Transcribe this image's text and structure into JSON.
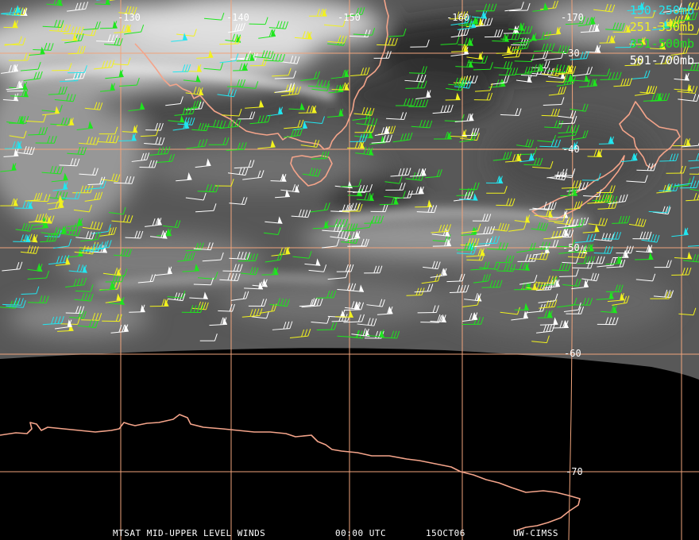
{
  "map": {
    "longitude_labels": [
      "-130",
      "-140",
      "-150",
      "-160",
      "-170"
    ],
    "latitude_labels": [
      "-30",
      "-40",
      "-50",
      "-60",
      "-70"
    ],
    "colors": {
      "grid": "#f0a47c",
      "coast": "#f4a48a",
      "background_space": "#000000",
      "cloud_bright": "#e8e8e8",
      "cloud_dark": "#2a2a2a"
    }
  },
  "legend": {
    "items": [
      {
        "label": "150-250mb",
        "color": "#22e6f0"
      },
      {
        "label": "251-350mb",
        "color": "#f2f21e"
      },
      {
        "label": "351-500mb",
        "color": "#1ee61e"
      },
      {
        "label": "501-700mb",
        "color": "#ffffff"
      }
    ]
  },
  "footer": {
    "product": "MTSAT MID-UPPER LEVEL WINDS",
    "time": "00:00 UTC",
    "date": "15OCT06",
    "source": "UW-CIMSS"
  }
}
